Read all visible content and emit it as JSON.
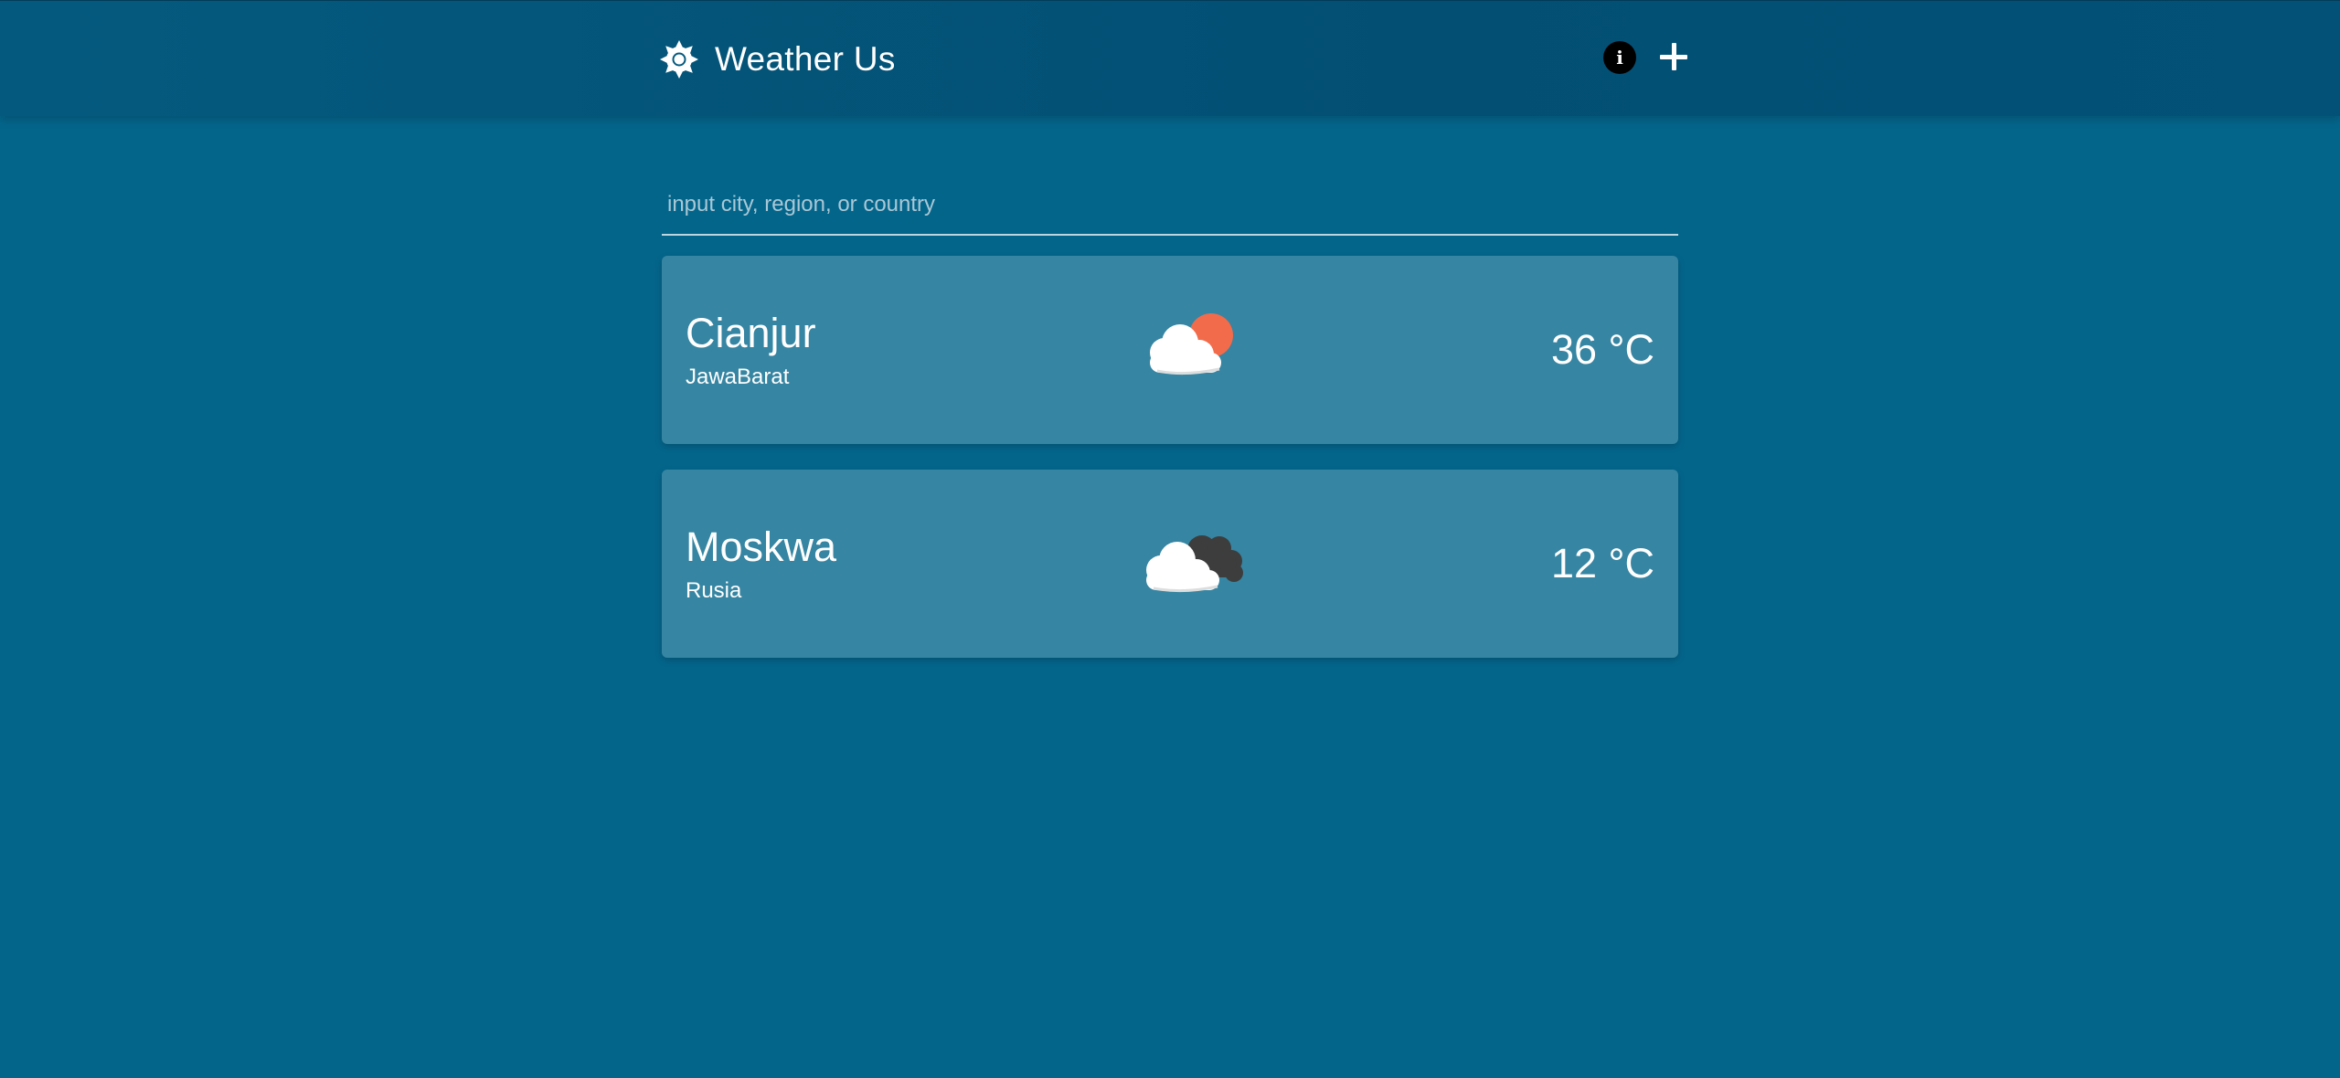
{
  "header": {
    "title": "Weather Us",
    "brand_icon": "sun-icon",
    "info_icon": "info-icon",
    "add_icon": "plus-icon"
  },
  "search": {
    "placeholder": "input city, region, or country",
    "value": ""
  },
  "cards": [
    {
      "city": "Cianjur",
      "region": "JawaBarat",
      "temperature": "36 °C",
      "icon": "partly-sunny-icon"
    },
    {
      "city": "Moskwa",
      "region": "Rusia",
      "temperature": "12 °C",
      "icon": "cloudy-icon"
    }
  ],
  "colors": {
    "background": "#04658b",
    "header": "#034f74",
    "card": "#3685a2",
    "sun": "#f26b4a",
    "cloud": "#f2f2f2",
    "dark_cloud": "#3d3d3d"
  }
}
